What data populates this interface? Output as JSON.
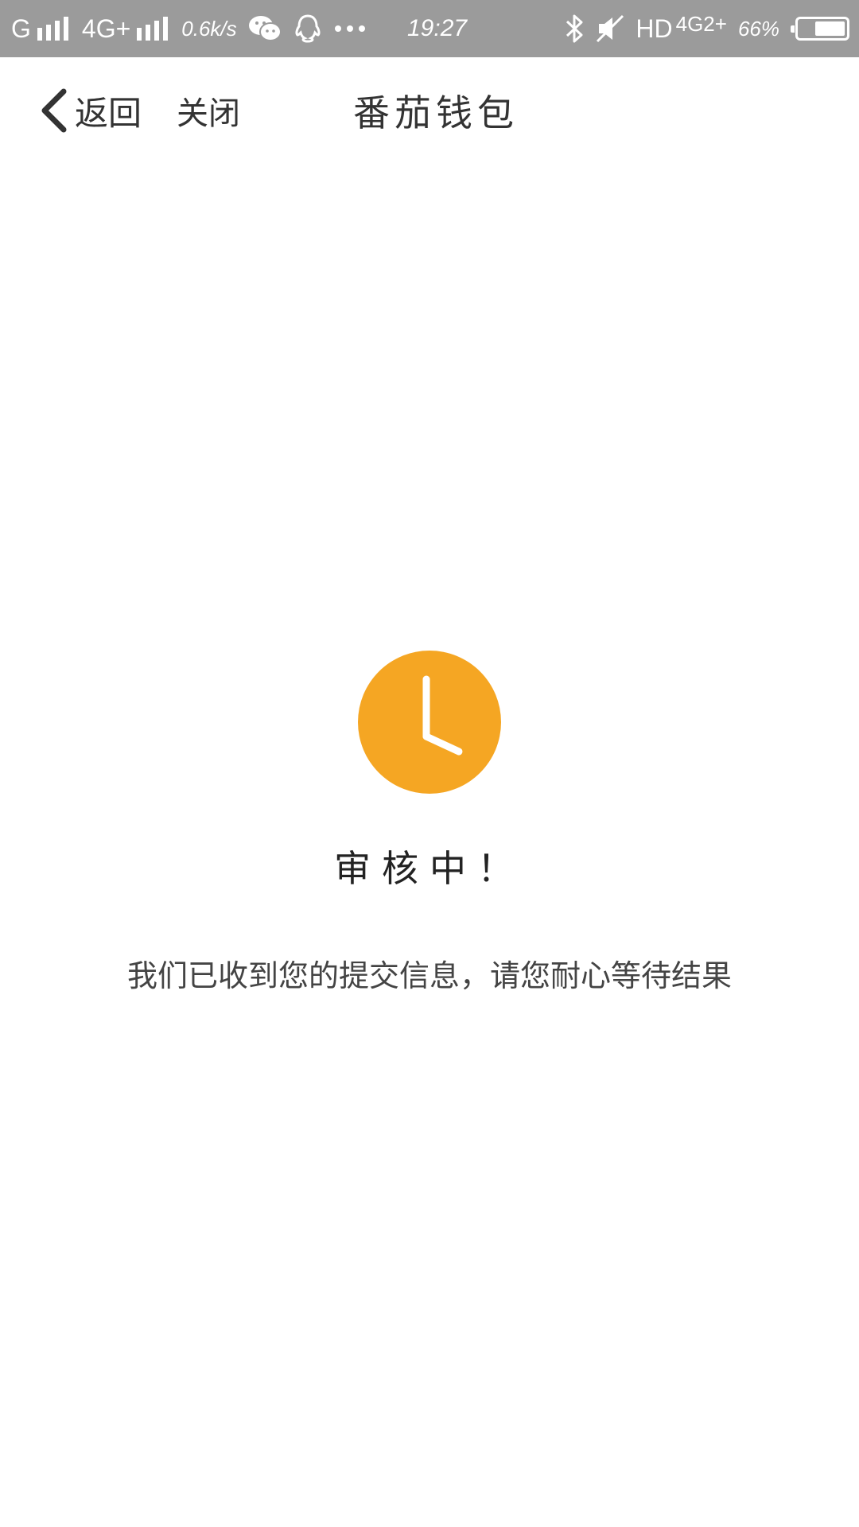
{
  "status_bar": {
    "carrier1": "G",
    "carrier2": "4G+",
    "net_speed": "0.6k/s",
    "time": "19:27",
    "hd_label": "HD",
    "network_right": "4G2+",
    "battery_percent": "66%",
    "battery_level": 0.66,
    "icons": [
      "signal-icon",
      "wechat-icon",
      "qq-icon",
      "more-icon",
      "bluetooth-icon",
      "mute-icon",
      "battery-icon"
    ]
  },
  "nav": {
    "back_label": "返回",
    "close_label": "关闭",
    "title": "番茄钱包"
  },
  "main": {
    "icon": "clock-icon",
    "status_title": "审核中！",
    "status_message": "我们已收到您的提交信息，请您耐心等待结果"
  },
  "colors": {
    "status_bar_bg": "#9b9b9b",
    "accent": "#f5a623",
    "background": "#ffffff"
  }
}
